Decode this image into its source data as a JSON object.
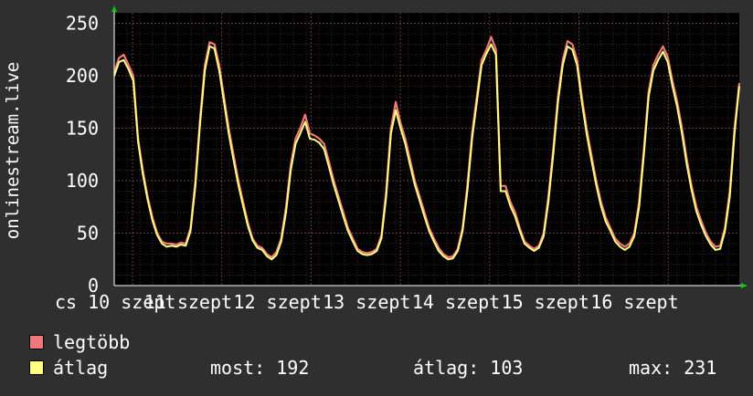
{
  "chart_data": {
    "type": "line",
    "ylabel": "onlinestream.live",
    "ylim": [
      0,
      260
    ],
    "yticks": [
      "0",
      "50",
      "100",
      "150",
      "200",
      "250"
    ],
    "xticks": [
      "cs 10 szept",
      "11 szept",
      "12 szept",
      "13 szept",
      "14 szept",
      "15 szept",
      "16 szept"
    ],
    "grid": true,
    "colors": {
      "max": "#f07878",
      "avg": "#ffff80",
      "background": "#000000",
      "grid": "#505050",
      "axis": "#ffffff",
      "arrow": "#00cc00"
    },
    "series": [
      {
        "name": "legtöbb",
        "values": [
          203,
          217,
          220,
          210,
          200,
          140,
          110,
          85,
          65,
          50,
          42,
          40,
          40,
          39,
          41,
          40,
          55,
          100,
          160,
          210,
          232,
          230,
          210,
          180,
          150,
          125,
          100,
          80,
          60,
          45,
          38,
          36,
          30,
          27,
          32,
          45,
          75,
          115,
          140,
          150,
          163,
          145,
          143,
          140,
          135,
          118,
          100,
          85,
          70,
          55,
          45,
          35,
          32,
          31,
          32,
          35,
          48,
          90,
          150,
          175,
          155,
          140,
          120,
          100,
          85,
          70,
          55,
          45,
          36,
          30,
          27,
          28,
          35,
          55,
          95,
          145,
          180,
          215,
          225,
          237,
          225,
          95,
          95,
          80,
          70,
          55,
          42,
          38,
          35,
          38,
          50,
          85,
          130,
          180,
          215,
          233,
          230,
          215,
          180,
          150,
          125,
          100,
          80,
          65,
          55,
          45,
          40,
          37,
          40,
          50,
          80,
          130,
          185,
          210,
          220,
          228,
          218,
          195,
          175,
          150,
          120,
          95,
          75,
          62,
          50,
          42,
          37,
          38,
          55,
          90,
          150,
          193
        ],
        "label_prefix": "max:",
        "label_value": "231"
      },
      {
        "name": "átlag",
        "values": [
          200,
          213,
          215,
          206,
          195,
          137,
          106,
          82,
          62,
          48,
          40,
          37,
          38,
          37,
          39,
          38,
          52,
          95,
          155,
          205,
          228,
          226,
          205,
          175,
          145,
          120,
          96,
          76,
          57,
          43,
          36,
          34,
          28,
          25,
          29,
          42,
          70,
          110,
          135,
          145,
          156,
          140,
          139,
          136,
          130,
          113,
          96,
          81,
          66,
          52,
          42,
          33,
          30,
          29,
          30,
          33,
          45,
          85,
          145,
          167,
          150,
          135,
          115,
          96,
          81,
          66,
          52,
          42,
          33,
          28,
          25,
          26,
          33,
          52,
          90,
          140,
          175,
          210,
          221,
          230,
          220,
          90,
          90,
          76,
          66,
          52,
          40,
          36,
          33,
          36,
          47,
          80,
          125,
          175,
          210,
          228,
          225,
          210,
          175,
          145,
          120,
          96,
          76,
          61,
          52,
          42,
          37,
          34,
          37,
          47,
          75,
          125,
          180,
          205,
          215,
          223,
          213,
          190,
          170,
          145,
          115,
          91,
          71,
          58,
          47,
          39,
          34,
          35,
          52,
          85,
          145,
          190
        ],
        "label_prefix": "átlag:",
        "label_value": "103",
        "extra_prefix": "most:",
        "extra_value": "192"
      }
    ]
  },
  "legend": {
    "max_label": "legtöbb",
    "avg_label": "átlag",
    "most": "most: 192",
    "atlag": "átlag: 103",
    "max": "max: 231"
  }
}
